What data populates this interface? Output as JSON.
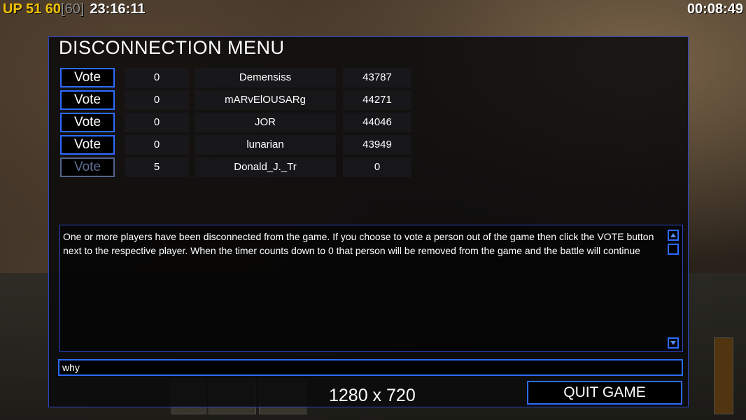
{
  "overlay": {
    "fps_text": "UP 51 60",
    "fps_bracket": "[60]",
    "clock": "23:16:11",
    "game_timer": "00:08:49"
  },
  "dialog": {
    "title": "DISCONNECTION MENU",
    "players": [
      {
        "vote_label": "Vote",
        "count": "0",
        "name": "Demensiss",
        "id": "43787",
        "enabled": true
      },
      {
        "vote_label": "Vote",
        "count": "0",
        "name": "mARvElOUSARg",
        "id": "44271",
        "enabled": true
      },
      {
        "vote_label": "Vote",
        "count": "0",
        "name": "JOR",
        "id": "44046",
        "enabled": true
      },
      {
        "vote_label": "Vote",
        "count": "0",
        "name": "lunarian",
        "id": "43949",
        "enabled": true
      },
      {
        "vote_label": "Vote",
        "count": "5",
        "name": "Donald_J._Tr",
        "id": "0",
        "enabled": false
      }
    ],
    "message": "One or more players have been disconnected from the game. If you choose to vote a person out of the game then click the VOTE button next to the respective player. When the timer counts down to 0 that person will be removed from the game and the battle will continue",
    "chat_value": "why",
    "quit_label": "QUIT GAME"
  },
  "resolution_label": "1280 x 720",
  "colors": {
    "accent": "#2d6bff",
    "panel_border": "#2a45c8",
    "fps": "#f2c200",
    "disabled": "#5f6d93"
  }
}
